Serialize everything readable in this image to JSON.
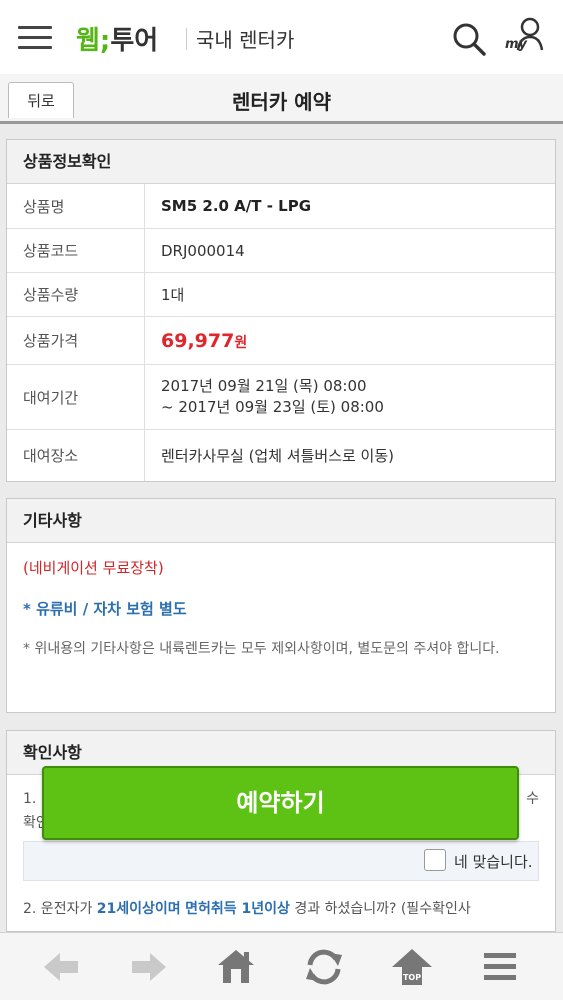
{
  "header": {
    "logo_web": "웹",
    "logo_dot": ";",
    "logo_tour": "투어",
    "subtitle": "국내 렌터카",
    "my_label": "my"
  },
  "titlebar": {
    "back_label": "뒤로",
    "title": "렌터카 예약"
  },
  "product_info": {
    "heading": "상품정보확인",
    "name_label": "상품명",
    "name_value": "SM5 2.0 A/T - LPG",
    "code_label": "상품코드",
    "code_value": "DRJ000014",
    "qty_label": "상품수량",
    "qty_value": "1대",
    "price_label": "상품가격",
    "price_value": "69,977",
    "price_unit": "원",
    "period_label": "대여기간",
    "period_start": "2017년 09월 21일 (목) 08:00",
    "period_end": "~ 2017년 09월 23일 (토) 08:00",
    "place_label": "대여장소",
    "place_value": "렌터카사무실 (업체 셔틀버스로 이동)"
  },
  "etc": {
    "heading": "기타사항",
    "red_line": "(네비게이션 무료장착)",
    "blue_line": "* 유류비 / 자차 보험 별도",
    "note": "* 위내용의 기타사항은 내륙렌트카는 모두 제외사항이며, 별도문의 주셔야 합니다."
  },
  "confirm": {
    "heading": "확인사항",
    "q1_start": "1.",
    "q1_end_1": "수",
    "q1_end_2": "확인",
    "agree_label": "네 맞습니다.",
    "q2_prefix": "2. 운전자가 ",
    "q2_hl1": "21세이상이며",
    "q2_mid": " ",
    "q2_hl2": "면허취득 1년이상",
    "q2_suffix": " 경과 하셨습니까? (필수확인사"
  },
  "reserve_button": "예약하기",
  "bottom_nav": {
    "top_label": "TOP"
  },
  "colors": {
    "brand_green": "#5dc214",
    "price_red": "#e0262a",
    "link_blue": "#2c6fb0"
  }
}
